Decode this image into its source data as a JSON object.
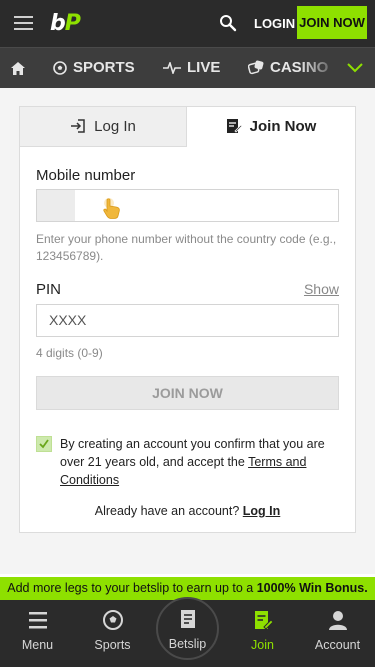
{
  "header": {
    "logo_b": "b",
    "logo_p": "P",
    "login_label": "LOGIN",
    "join_label": "JOIN NOW",
    "accent_color": "#8ee000"
  },
  "nav": {
    "items": [
      {
        "label": "",
        "icon": "home-icon"
      },
      {
        "label": "SPORTS",
        "icon": "soccer-ball-icon"
      },
      {
        "label": "LIVE",
        "icon": "pulse-icon"
      },
      {
        "label": "CASINO",
        "icon": "dice-icon"
      }
    ],
    "more_icon": "chevron-down-icon"
  },
  "tabs": {
    "login": "Log In",
    "join": "Join Now"
  },
  "form": {
    "mobile_label": "Mobile number",
    "mobile_value": "",
    "phone_hint": "Enter your phone number without the country code (e.g., 123456789).",
    "pin_label": "PIN",
    "show_label": "Show",
    "pin_placeholder": "XXXX",
    "pin_hint": "4 digits (0-9)",
    "submit_label": "JOIN NOW",
    "consent_text": "By creating an account you confirm that you are over 21 years old, and accept the ",
    "terms_link": "Terms and Conditions",
    "already_text": "Already have an account? ",
    "login_link": "Log In"
  },
  "promo": {
    "text": "Add more legs to your betslip to earn up to a ",
    "bold": "1000% Win Bonus."
  },
  "bottom_nav": {
    "menu": "Menu",
    "sports": "Sports",
    "betslip": "Betslip",
    "join": "Join",
    "account": "Account"
  }
}
